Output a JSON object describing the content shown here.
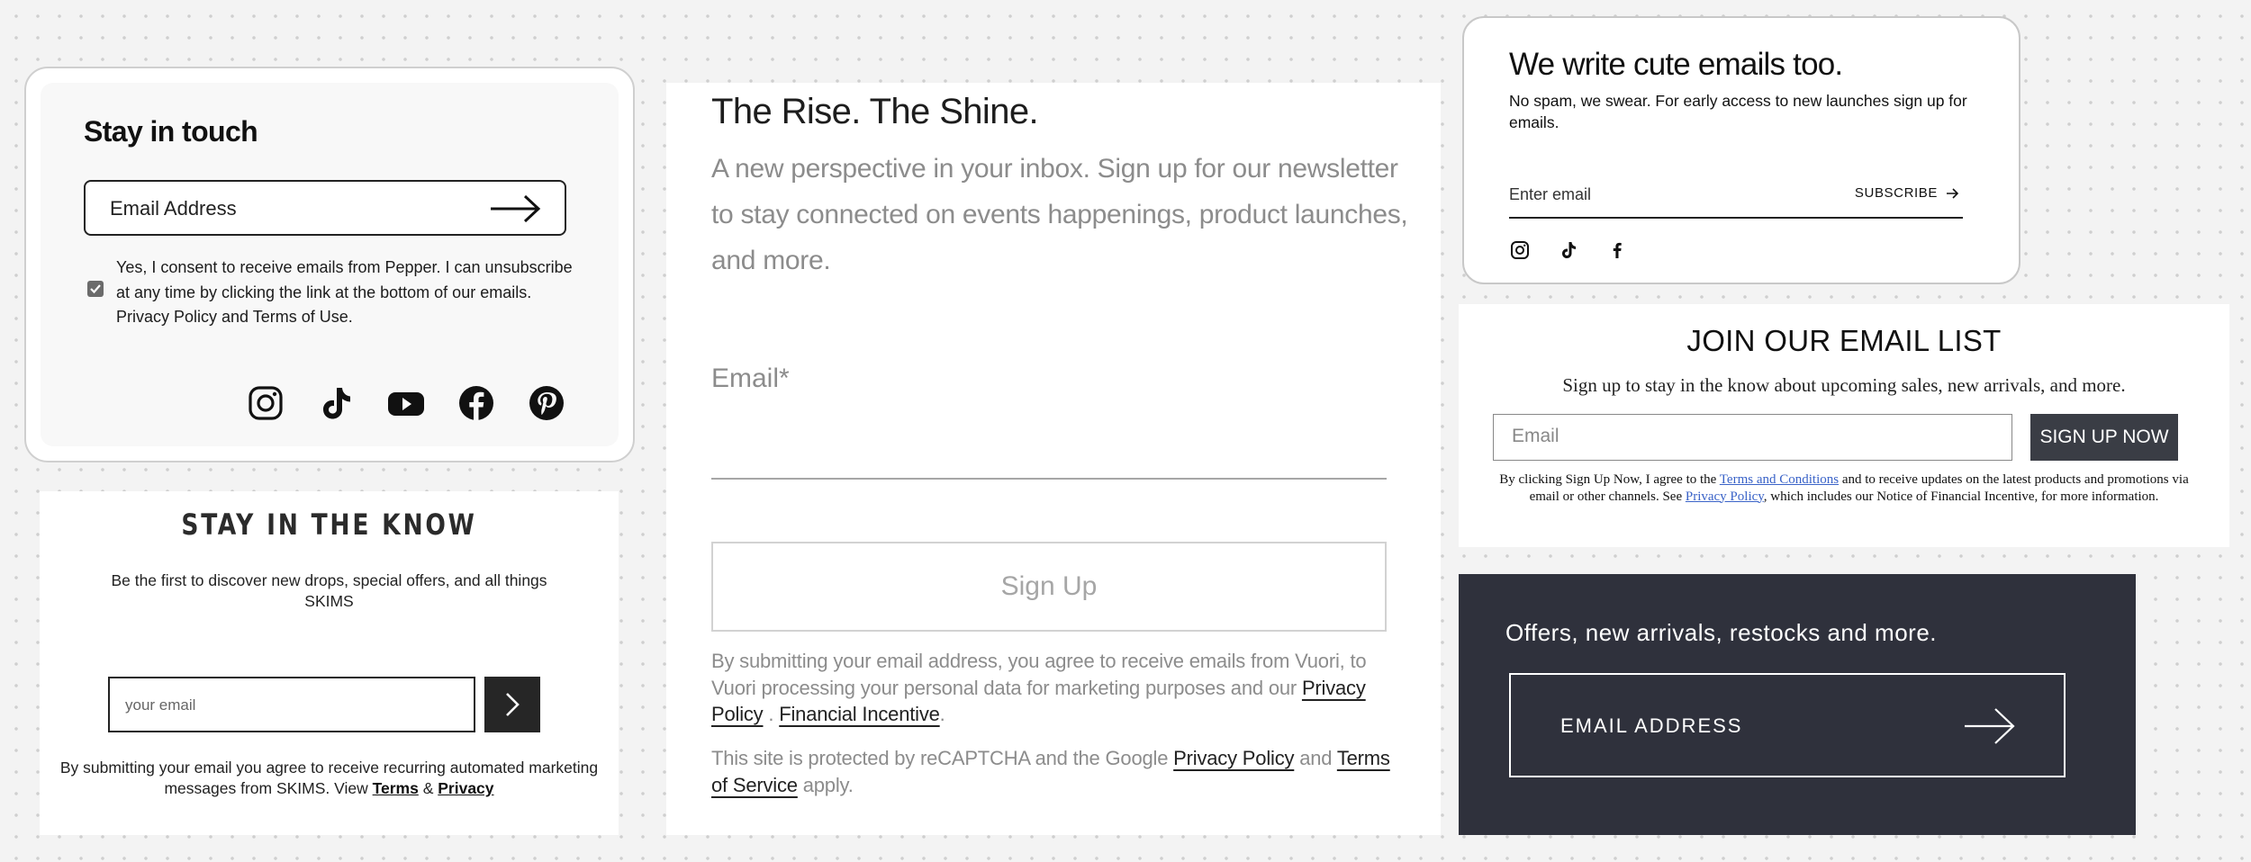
{
  "pepper": {
    "title": "Stay in touch",
    "email_placeholder": "Email Address",
    "consent_checked": true,
    "consent_text": "Yes, I consent to receive emails from Pepper. I can unsubscribe at any time by clicking the link at the bottom of our emails. Privacy Policy and Terms of Use.",
    "social_icons": [
      "instagram-icon",
      "tiktok-icon",
      "youtube-icon",
      "facebook-icon",
      "pinterest-icon"
    ]
  },
  "skims": {
    "title": "STAY IN THE KNOW",
    "description": "Be the first to discover new drops, special offers, and all things SKIMS",
    "email_placeholder": "your email",
    "legal_prefix": "By submitting your email you agree to receive recurring automated marketing messages from SKIMS. View ",
    "terms_label": "Terms",
    "amp": " & ",
    "privacy_label": "Privacy"
  },
  "vuori": {
    "title": "The Rise. The Shine.",
    "subtitle": "A new perspective in your inbox. Sign up for our newsletter to stay connected on events happenings, product launches, and more.",
    "email_label": "Email*",
    "signup_label": "Sign Up",
    "legal1_prefix": "By submitting your email address, you agree to receive emails from Vuori, to Vuori processing your personal data for marketing purposes and our ",
    "privacy_label": "Privacy Policy",
    "legal1_mid": " . ",
    "financial_label": "Financial Incentive",
    "legal1_end": ".",
    "legal2_prefix": "This site is protected by reCAPTCHA and the Google ",
    "google_privacy_label": "Privacy Policy",
    "and": " and ",
    "terms_label": "Terms of Service",
    "legal2_end": " apply."
  },
  "cute": {
    "title": "We write cute emails too.",
    "description": "No spam, we swear. For early access to new launches sign up for emails.",
    "email_placeholder": "Enter email",
    "subscribe_label": "SUBSCRIBE",
    "social_icons": [
      "instagram-icon",
      "tiktok-icon",
      "facebook-icon"
    ]
  },
  "join": {
    "title": "JOIN OUR EMAIL LIST",
    "description": "Sign up to stay in the know about upcoming sales, new arrivals, and more.",
    "email_placeholder": "Email",
    "button_label": "SIGN UP NOW",
    "legal_prefix": "By clicking Sign Up Now, I agree to the ",
    "terms_label": "Terms and Conditions",
    "legal_mid": " and to receive updates on the latest products and promotions via email or other channels. See ",
    "privacy_label": "Privacy Policy",
    "legal_end": ", which includes our Notice of Financial Incentive, for more information.",
    "link_color": "#3a63c8",
    "button_color": "#3a3d45"
  },
  "offers": {
    "title": "Offers, new arrivals, restocks and more.",
    "email_placeholder": "EMAIL ADDRESS",
    "background_color": "#2f313c"
  }
}
